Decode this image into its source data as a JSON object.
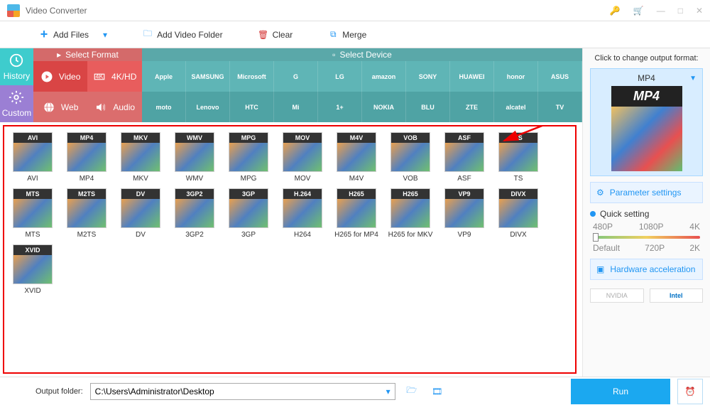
{
  "app": {
    "title": "Video Converter"
  },
  "toolbar": {
    "add_files": "Add Files",
    "add_folder": "Add Video Folder",
    "clear": "Clear",
    "merge": "Merge"
  },
  "side_tabs": {
    "history": "History",
    "custom": "Custom"
  },
  "format_header": "Select Format",
  "device_header": "Select Device",
  "mid_tabs": {
    "video": "Video",
    "hd": "4K/HD",
    "web": "Web",
    "audio": "Audio"
  },
  "devices_row1": [
    "Apple",
    "SAMSUNG",
    "Microsoft",
    "G",
    "LG",
    "amazon",
    "SONY",
    "HUAWEI",
    "honor",
    "ASUS"
  ],
  "devices_row2": [
    "moto",
    "Lenovo",
    "HTC",
    "Mi",
    "1+",
    "NOKIA",
    "BLU",
    "ZTE",
    "alcatel",
    "TV"
  ],
  "formats": [
    {
      "badge": "AVI",
      "label": "AVI"
    },
    {
      "badge": "MP4",
      "label": "MP4"
    },
    {
      "badge": "MKV",
      "label": "MKV"
    },
    {
      "badge": "WMV",
      "label": "WMV"
    },
    {
      "badge": "MPG",
      "label": "MPG"
    },
    {
      "badge": "MOV",
      "label": "MOV"
    },
    {
      "badge": "M4V",
      "label": "M4V"
    },
    {
      "badge": "VOB",
      "label": "VOB"
    },
    {
      "badge": "ASF",
      "label": "ASF"
    },
    {
      "badge": "TS",
      "label": "TS"
    },
    {
      "badge": "MTS",
      "label": "MTS"
    },
    {
      "badge": "M2TS",
      "label": "M2TS"
    },
    {
      "badge": "DV",
      "label": "DV"
    },
    {
      "badge": "3GP2",
      "label": "3GP2"
    },
    {
      "badge": "3GP",
      "label": "3GP"
    },
    {
      "badge": "H.264",
      "label": "H264"
    },
    {
      "badge": "H265",
      "label": "H265 for MP4"
    },
    {
      "badge": "H265",
      "label": "H265 for MKV"
    },
    {
      "badge": "VP9",
      "label": "VP9"
    },
    {
      "badge": "DIVX",
      "label": "DIVX"
    },
    {
      "badge": "XVID",
      "label": "XVID"
    }
  ],
  "right": {
    "change_label": "Click to change output format:",
    "selected_format": "MP4",
    "selected_badge": "MP4",
    "parameter_settings": "Parameter settings",
    "quick_setting": "Quick setting",
    "slider_labels_top": [
      "480P",
      "1080P",
      "4K"
    ],
    "slider_labels_bottom": [
      "Default",
      "720P",
      "2K"
    ],
    "hardware_accel": "Hardware acceleration",
    "nvidia": "NVIDIA",
    "intel": "Intel"
  },
  "bottom": {
    "output_folder_label": "Output folder:",
    "output_folder_path": "C:\\Users\\Administrator\\Desktop",
    "run": "Run"
  }
}
